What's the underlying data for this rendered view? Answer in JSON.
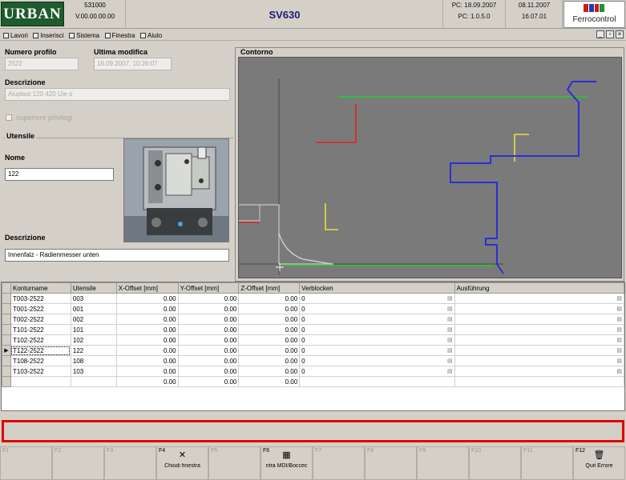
{
  "header": {
    "logo": "URBAN",
    "code": "531000",
    "version": "V.00.00.00.00",
    "title": "SV630",
    "pc_label_1": "PC: 18.09.2007",
    "pc_label_2": "PC: 1.0.5.0",
    "date": "08.11.2007",
    "time": "16.07.01",
    "brand": "Ferrocontrol"
  },
  "menu": [
    {
      "label": "Lavori"
    },
    {
      "label": "Inserisci"
    },
    {
      "label": "Sistema"
    },
    {
      "label": "Finestra"
    },
    {
      "label": "Aiuto"
    }
  ],
  "form": {
    "numero_profilo_label": "Numero profilo",
    "numero_profilo_value": "2522",
    "ultima_modifica_label": "Ultima modifica",
    "ultima_modifica_value": "16.09.2007, 10:26:07",
    "descrizione_label": "Descrizione",
    "descrizione_value": "Aluplast 120 420 Uie o",
    "superiore_label": "superiore privilegi",
    "utensile_group_label": "Utensile",
    "nome_label": "Nome",
    "nome_value": "122",
    "utensile_descr_label": "Descrizione",
    "utensile_descr_value": "Innenfalz - Radienmesser unten"
  },
  "contorno": {
    "title": "Contorno"
  },
  "table": {
    "columns": [
      "Konturname",
      "Utensile",
      "X-Offset [mm]",
      "Y-Offset [mm]",
      "Z-Offset [mm]",
      "Verblocken",
      "Ausführung"
    ],
    "rows": [
      {
        "name": "T003-2522",
        "utensile": "003",
        "x": "0.00",
        "y": "0.00",
        "z": "0.00",
        "verb": "0",
        "aus": ""
      },
      {
        "name": "T001-2522",
        "utensile": "001",
        "x": "0.00",
        "y": "0.00",
        "z": "0.00",
        "verb": "0",
        "aus": ""
      },
      {
        "name": "T002-2522",
        "utensile": "002",
        "x": "0.00",
        "y": "0.00",
        "z": "0.00",
        "verb": "0",
        "aus": ""
      },
      {
        "name": "T101-2522",
        "utensile": "101",
        "x": "0.00",
        "y": "0.00",
        "z": "0.00",
        "verb": "0",
        "aus": ""
      },
      {
        "name": "T102-2522",
        "utensile": "102",
        "x": "0.00",
        "y": "0.00",
        "z": "0.00",
        "verb": "0",
        "aus": ""
      },
      {
        "name": "T122-2522",
        "utensile": "122",
        "x": "0.00",
        "y": "0.00",
        "z": "0.00",
        "verb": "0",
        "aus": "",
        "selected": true
      },
      {
        "name": "T108-2522",
        "utensile": "108",
        "x": "0.00",
        "y": "0.00",
        "z": "0.00",
        "verb": "0",
        "aus": ""
      },
      {
        "name": "T103-2522",
        "utensile": "103",
        "x": "0.00",
        "y": "0.00",
        "z": "0.00",
        "verb": "0",
        "aus": ""
      },
      {
        "name": "",
        "utensile": "",
        "x": "0.00",
        "y": "0.00",
        "z": "0.00",
        "verb": "",
        "aus": ""
      }
    ],
    "selected_marker": "▶"
  },
  "fkeys": [
    {
      "key": "F1",
      "label": "",
      "icon": ""
    },
    {
      "key": "F2",
      "label": "",
      "icon": ""
    },
    {
      "key": "F3",
      "label": "",
      "icon": ""
    },
    {
      "key": "F4",
      "label": "Chiudi finestra",
      "icon": "✕",
      "active": true
    },
    {
      "key": "F5",
      "label": "",
      "icon": ""
    },
    {
      "key": "F6",
      "label": "ntra MDI/Boccec",
      "icon": "▦",
      "active": true
    },
    {
      "key": "F7",
      "label": "",
      "icon": ""
    },
    {
      "key": "F8",
      "label": "",
      "icon": ""
    },
    {
      "key": "F9",
      "label": "",
      "icon": ""
    },
    {
      "key": "F10",
      "label": "",
      "icon": ""
    },
    {
      "key": "F11",
      "label": "",
      "icon": ""
    },
    {
      "key": "F12",
      "label": "Quit Errore",
      "icon": "🗑",
      "active": true
    }
  ],
  "colors": {
    "logo_bg": "#1f5b2d",
    "canvas_bg": "#7a7a7a",
    "contour_blue": "#2a2fd6",
    "line_green": "#1fcf2a",
    "line_red": "#e02020",
    "line_yellow": "#e6e040",
    "message_border": "#e00000"
  }
}
